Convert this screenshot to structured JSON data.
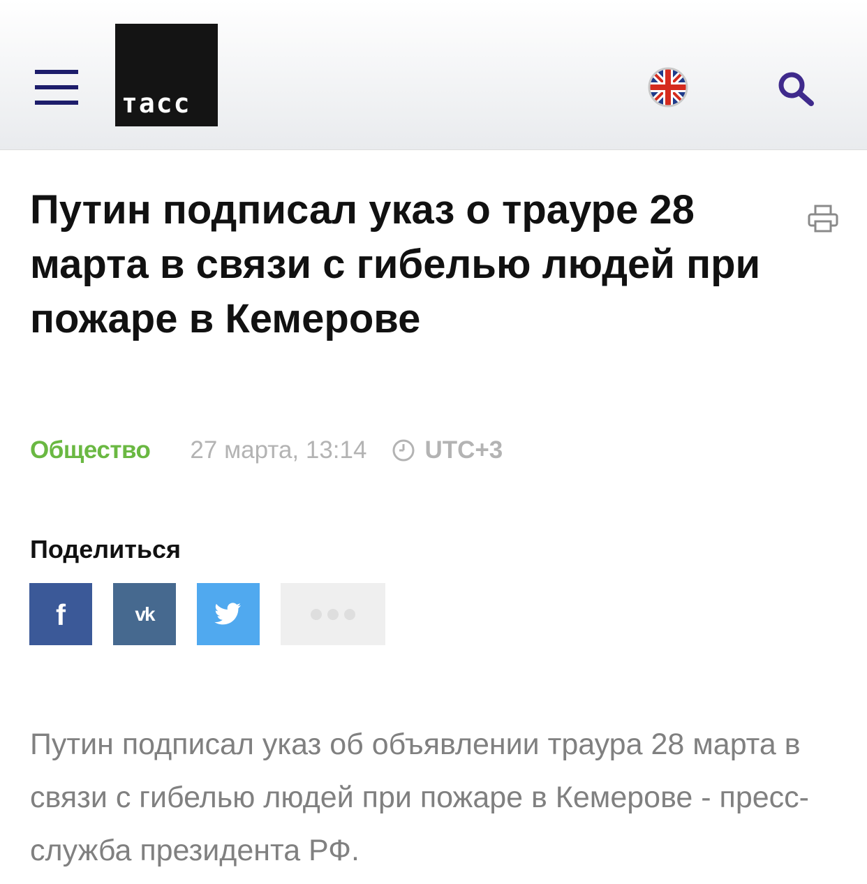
{
  "header": {
    "logo_text": "тасс",
    "menu_icon": "hamburger-menu-icon",
    "language_icon": "uk-flag-icon",
    "search_icon": "search-icon",
    "logo_color": "#141414",
    "menu_color": "#1d1d6b",
    "search_color": "#3f2a8c"
  },
  "article": {
    "title": "Путин подписал указ о трауре 28 марта в связи с гибелью людей при пожаре в Кемерове",
    "print_icon": "printer-icon",
    "category": "Общество",
    "category_color": "#6ab842",
    "date": "27 марта, 13:14",
    "timezone": "UTC+3",
    "lead": "Путин подписал указ об объявлении траура 28 марта в связи с гибелью людей при пожаре в Кемерове - пресс-служба президента РФ."
  },
  "share": {
    "title": "Поделиться",
    "buttons": [
      {
        "network": "facebook",
        "label": "f",
        "icon": "facebook-icon",
        "color": "#3b5998"
      },
      {
        "network": "vk",
        "label": "vk",
        "icon": "vk-icon",
        "color": "#46698f"
      },
      {
        "network": "twitter",
        "icon": "twitter-bird-icon",
        "color": "#50a9ef"
      },
      {
        "network": "more",
        "icon": "more-dots-icon",
        "color": "#efefef"
      }
    ]
  }
}
